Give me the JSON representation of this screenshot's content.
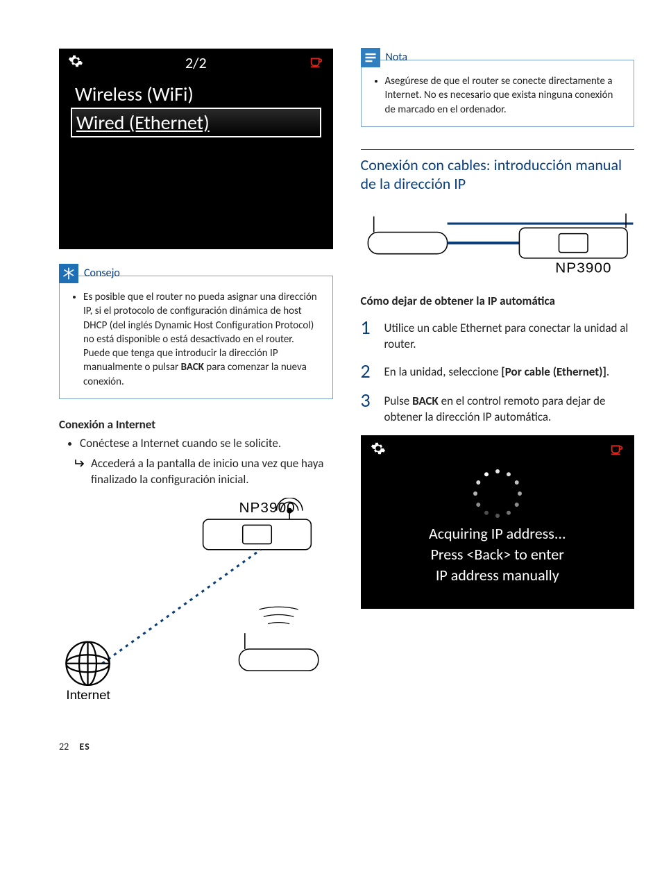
{
  "screen_menu": {
    "counter": "2/2",
    "item_wifi": "Wireless (WiFi)",
    "item_wired": "Wired (Ethernet)"
  },
  "tip": {
    "title": "Consejo",
    "text": "Es posible que el router no pueda asignar una dirección IP, si el protocolo de configuración dinámica de host DHCP (del inglés Dynamic Host Configuration Protocol) no está disponible o está desactivado en el router. Puede que tenga que introducir la dirección IP manualmente o pulsar ",
    "bold": "BACK",
    "text2": " para comenzar la nueva conexión."
  },
  "connect_heading": "Conexión a Internet",
  "connect_bullet": "Conéctese a Internet cuando se le solicite.",
  "connect_sub": "Accederá a la pantalla de inicio una vez que haya finalizado la configuración inicial.",
  "diagram1": {
    "device_label": "NP3900",
    "internet_label": "Internet"
  },
  "note": {
    "title": "Nota",
    "text": "Asegúrese de que el router se conecte directamente a Internet. No es necesario que exista ninguna conexión de marcado en el ordenador."
  },
  "section_title": "Conexión con cables: introducción manual de la dirección IP",
  "diagram2": {
    "device_label": "NP3900"
  },
  "stop_auto_heading": "Cómo dejar de obtener la IP automática",
  "steps": {
    "s1": "Utilice un cable Ethernet para conectar la unidad al router.",
    "s2_a": "En la unidad, seleccione ",
    "s2_b": "[Por cable (Ethernet)]",
    "s2_c": ".",
    "s3_a": "Pulse ",
    "s3_b": "BACK",
    "s3_c": " en el control remoto para dejar de obtener la dirección IP automática."
  },
  "screen_acq": {
    "line1": "Acquiring IP address...",
    "line2": "Press <Back> to enter",
    "line3": "IP address manually"
  },
  "footer": {
    "page": "22",
    "lang": "ES"
  }
}
